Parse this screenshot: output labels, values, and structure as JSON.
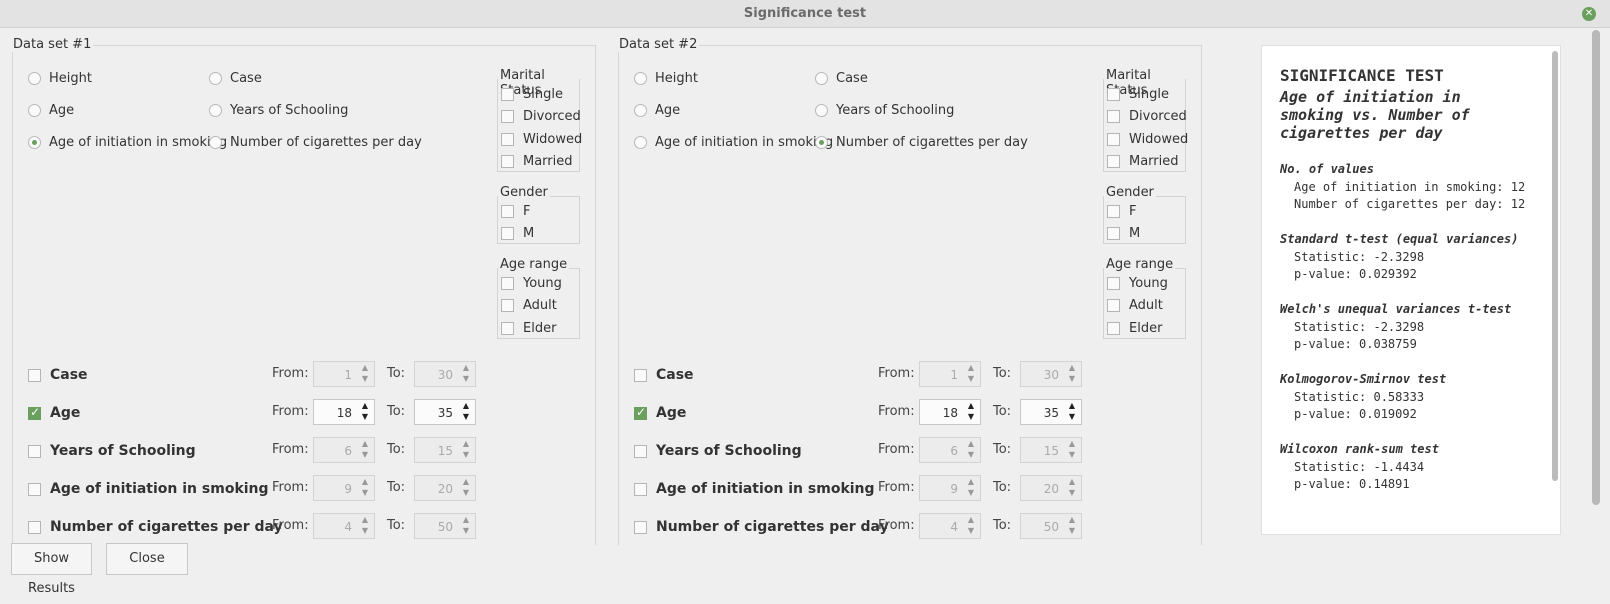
{
  "window": {
    "title": "Significance test"
  },
  "ds1": {
    "label": "Data set #1",
    "radios": [
      {
        "label": "Height",
        "checked": false
      },
      {
        "label": "Case",
        "checked": false
      },
      {
        "label": "Age",
        "checked": false
      },
      {
        "label": "Years of Schooling",
        "checked": false
      },
      {
        "label": "Age of initiation in smoking",
        "checked": true
      },
      {
        "label": "Number of cigarettes per day",
        "checked": false
      }
    ],
    "marital": {
      "label": "Marital Status",
      "items": [
        "Single",
        "Divorced",
        "Widowed",
        "Married"
      ]
    },
    "gender": {
      "label": "Gender",
      "items": [
        "F",
        "M"
      ]
    },
    "agerange": {
      "label": "Age range",
      "items": [
        "Young",
        "Adult",
        "Elder"
      ]
    },
    "filters": [
      {
        "label": "Case",
        "checked": false,
        "from": "1",
        "to": "30"
      },
      {
        "label": "Age",
        "checked": true,
        "from": "18",
        "to": "35"
      },
      {
        "label": "Years of Schooling",
        "checked": false,
        "from": "6",
        "to": "15"
      },
      {
        "label": "Age of initiation in smoking",
        "checked": false,
        "from": "9",
        "to": "20"
      },
      {
        "label": "Number of cigarettes per day",
        "checked": false,
        "from": "4",
        "to": "50"
      }
    ]
  },
  "ds2": {
    "label": "Data set #2",
    "radios": [
      {
        "label": "Height",
        "checked": false
      },
      {
        "label": "Case",
        "checked": false
      },
      {
        "label": "Age",
        "checked": false
      },
      {
        "label": "Years of Schooling",
        "checked": false
      },
      {
        "label": "Age of initiation in smoking",
        "checked": false
      },
      {
        "label": "Number of cigarettes per day",
        "checked": true
      }
    ],
    "marital": {
      "label": "Marital Status",
      "items": [
        "Single",
        "Divorced",
        "Widowed",
        "Married"
      ]
    },
    "gender": {
      "label": "Gender",
      "items": [
        "F",
        "M"
      ]
    },
    "agerange": {
      "label": "Age range",
      "items": [
        "Young",
        "Adult",
        "Elder"
      ]
    },
    "filters": [
      {
        "label": "Case",
        "checked": false,
        "from": "1",
        "to": "30"
      },
      {
        "label": "Age",
        "checked": true,
        "from": "18",
        "to": "35"
      },
      {
        "label": "Years of Schooling",
        "checked": false,
        "from": "6",
        "to": "15"
      },
      {
        "label": "Age of initiation in smoking",
        "checked": false,
        "from": "9",
        "to": "20"
      },
      {
        "label": "Number of cigarettes per day",
        "checked": false,
        "from": "4",
        "to": "50"
      }
    ]
  },
  "labels": {
    "from": "From:",
    "to": "To:"
  },
  "results": {
    "title": "SIGNIFICANCE TEST",
    "subtitle": "Age of initiation in smoking vs. Number of cigarettes per day",
    "sections": [
      {
        "heading": "No. of values",
        "lines": [
          "Age of initiation in smoking: 12",
          "Number of cigarettes per day: 12"
        ]
      },
      {
        "heading": "Standard t-test (equal variances)",
        "lines": [
          "Statistic: -2.3298",
          "p-value: 0.029392"
        ]
      },
      {
        "heading": "Welch's unequal variances t-test",
        "lines": [
          "Statistic: -2.3298",
          "p-value: 0.038759"
        ]
      },
      {
        "heading": "Kolmogorov-Smirnov test",
        "lines": [
          "Statistic: 0.58333",
          "p-value: 0.019092"
        ]
      },
      {
        "heading": "Wilcoxon rank-sum test",
        "lines": [
          "Statistic: -1.4434",
          "p-value: 0.14891"
        ]
      }
    ]
  },
  "buttons": {
    "show": "Show Results",
    "close": "Close"
  }
}
